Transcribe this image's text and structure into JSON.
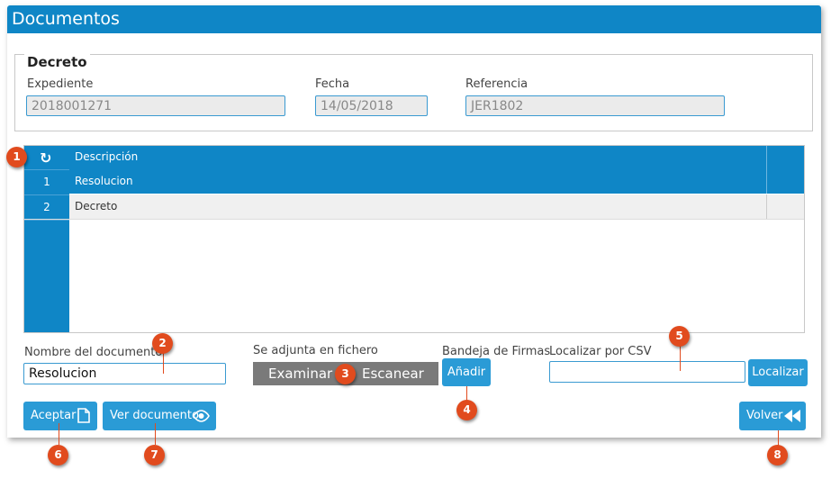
{
  "window": {
    "title": "Documentos"
  },
  "decreto": {
    "legend": "Decreto",
    "expediente": {
      "label": "Expediente",
      "value": "2018001271"
    },
    "fecha": {
      "label": "Fecha",
      "value": "14/05/2018"
    },
    "referencia": {
      "label": "Referencia",
      "value": "JER1802"
    }
  },
  "grid": {
    "header": "Descripción",
    "refresh_icon": "refresh-icon",
    "rows": [
      {
        "num": "1",
        "descripcion": "Resolucion",
        "selected": true
      },
      {
        "num": "2",
        "descripcion": "Decreto",
        "selected": false
      }
    ]
  },
  "form": {
    "nombre": {
      "label": "Nombre del documento",
      "value": "Resolucion"
    },
    "adjunta": {
      "label": "Se adjunta en fichero",
      "examinar": "Examinar",
      "escanear": "Escanear"
    },
    "bandeja": {
      "label": "Bandeja de Firmas",
      "button": "Añadir"
    },
    "csv": {
      "label": "Localizar por CSV",
      "value": "",
      "button": "Localizar"
    }
  },
  "actions": {
    "aceptar": "Aceptar",
    "ver_documento": "Ver documento",
    "volver": "Volver"
  },
  "callouts": [
    "1",
    "2",
    "3",
    "4",
    "5",
    "6",
    "7",
    "8"
  ],
  "colors": {
    "accent": "#0f86c6",
    "callout": "#e14b1e",
    "button": "#2a9bd6"
  }
}
